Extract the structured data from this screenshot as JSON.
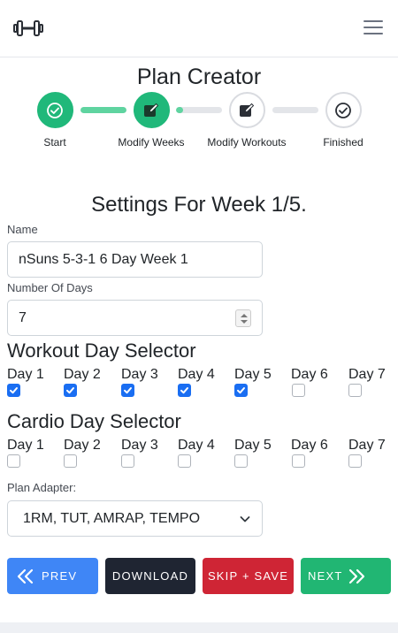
{
  "nav": {
    "logo": "dumbbell-icon",
    "menu": "hamburger-icon"
  },
  "page": {
    "title": "Plan Creator"
  },
  "steps": [
    {
      "label": "Start",
      "status": "done",
      "icon": "check-circle-icon"
    },
    {
      "label": "Modify Weeks",
      "status": "current",
      "icon": "edit-square-icon"
    },
    {
      "label": "Modify Workouts",
      "status": "todo",
      "icon": "edit-square-icon"
    },
    {
      "label": "Finished",
      "status": "todo",
      "icon": "check-circle-icon"
    }
  ],
  "progress": [
    1.0,
    0.15,
    0.0
  ],
  "settings": {
    "title": "Settings For Week 1/5.",
    "name_label": "Name",
    "name_value": "nSuns 5-3-1 6 Day Week 1",
    "days_label": "Number Of Days",
    "days_value": "7"
  },
  "workout_selector": {
    "title": "Workout Day Selector",
    "days": [
      {
        "label": "Day 1",
        "checked": true
      },
      {
        "label": "Day 2",
        "checked": true
      },
      {
        "label": "Day 3",
        "checked": true
      },
      {
        "label": "Day 4",
        "checked": true
      },
      {
        "label": "Day 5",
        "checked": true
      },
      {
        "label": "Day 6",
        "checked": false
      },
      {
        "label": "Day 7",
        "checked": false
      }
    ]
  },
  "cardio_selector": {
    "title": "Cardio Day Selector",
    "days": [
      {
        "label": "Day 1",
        "checked": false
      },
      {
        "label": "Day 2",
        "checked": false
      },
      {
        "label": "Day 3",
        "checked": false
      },
      {
        "label": "Day 4",
        "checked": false
      },
      {
        "label": "Day 5",
        "checked": false
      },
      {
        "label": "Day 6",
        "checked": false
      },
      {
        "label": "Day 7",
        "checked": false
      }
    ]
  },
  "adapter": {
    "label": "Plan Adapter:",
    "value": "1RM, TUT, AMRAP, TEMPO"
  },
  "buttons": {
    "prev": "PREV",
    "download": "DOWNLOAD",
    "skip": "SKIP + SAVE",
    "next": "NEXT"
  },
  "colors": {
    "success": "#20b87a",
    "primary": "#3f86f6",
    "dark": "#1f2532",
    "danger": "#cf2535",
    "checkbox": "#1a6ef2"
  }
}
